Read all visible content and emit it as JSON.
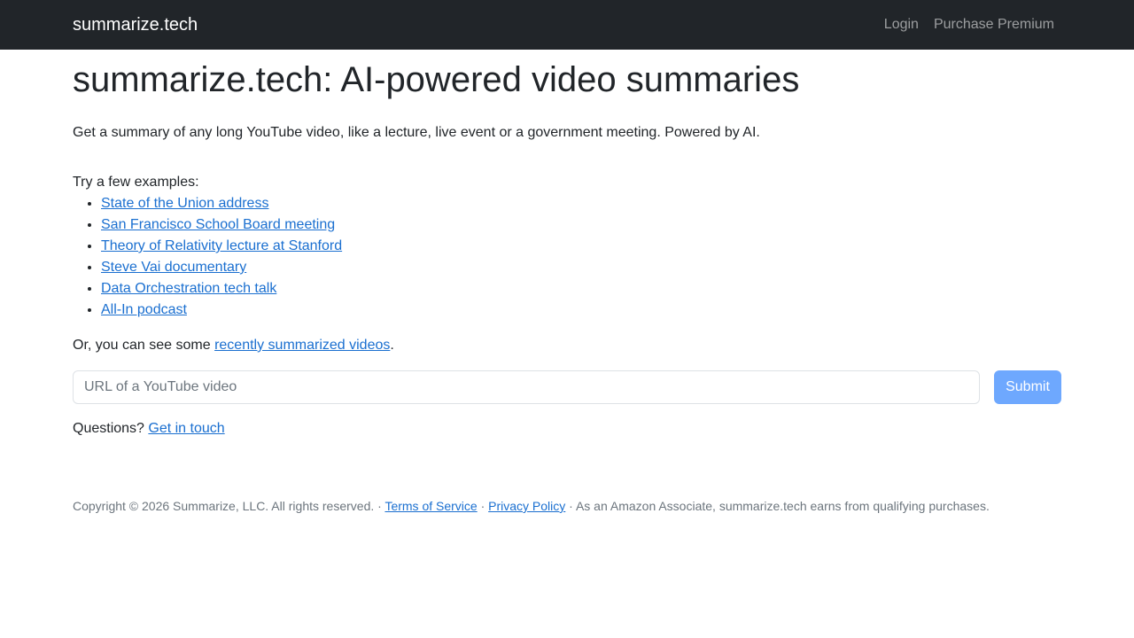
{
  "nav": {
    "brand": "summarize.tech",
    "links": [
      "Login",
      "Purchase Premium"
    ]
  },
  "main": {
    "title": "summarize.tech: AI-powered video summaries",
    "lead": "Get a summary of any long YouTube video, like a lecture, live event or a government meeting. Powered by AI.",
    "examples_intro": "Try a few examples:",
    "examples": [
      "State of the Union address",
      "San Francisco School Board meeting",
      "Theory of Relativity lecture at Stanford",
      "Steve Vai documentary",
      "Data Orchestration tech talk",
      "All-In podcast"
    ],
    "recent_prefix": "Or, you can see some ",
    "recent_link": "recently summarized videos",
    "recent_suffix": ".",
    "url_placeholder": "URL of a YouTube video",
    "submit_label": "Submit",
    "questions_prefix": "Questions? ",
    "questions_link": "Get in touch"
  },
  "footer": {
    "copyright": "Copyright © 2026 Summarize, LLC. All rights reserved. · ",
    "terms": "Terms of Service",
    "sep": " · ",
    "privacy": "Privacy Policy",
    "associate": " · As an Amazon Associate, summarize.tech earns from qualifying purchases."
  },
  "colors": {
    "navbar_bg": "#212529",
    "link": "#1a6fd0",
    "submit_bg": "#6ea8fe"
  }
}
